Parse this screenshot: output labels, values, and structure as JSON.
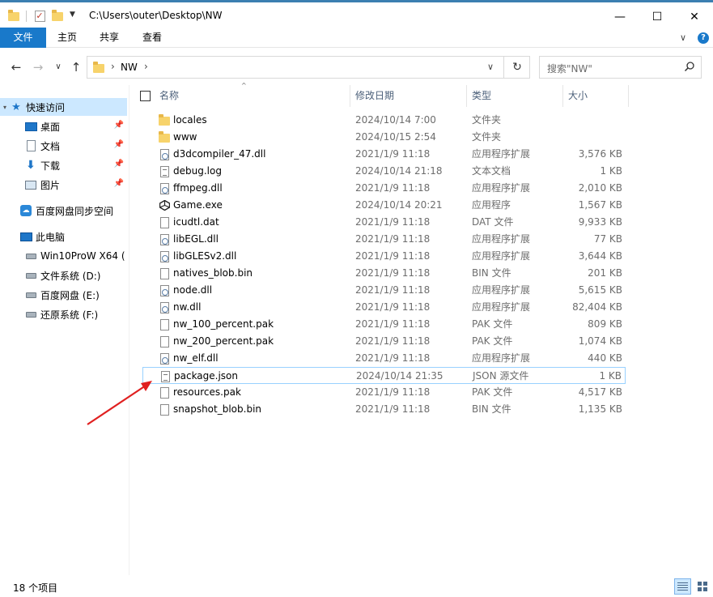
{
  "window": {
    "title_path": "C:\\Users\\outer\\Desktop\\NW",
    "minimize_glyph": "—",
    "maximize_glyph": "☐",
    "close_glyph": "✕"
  },
  "ribbon": {
    "tabs": [
      "文件",
      "主页",
      "共享",
      "查看"
    ],
    "expand_glyph": "∨",
    "help_glyph": "?"
  },
  "address": {
    "back_glyph": "←",
    "forward_glyph": "→",
    "recent_glyph": "∨",
    "up_glyph": "↑",
    "folder_name": "NW",
    "chevron": "›",
    "dropdown_glyph": "∨",
    "refresh_glyph": "↻",
    "search_placeholder": "搜索\"NW\""
  },
  "nav": {
    "quick_access": "快速访问",
    "pinned": [
      "桌面",
      "文档",
      "下载",
      "图片"
    ],
    "cloud_sync": "百度网盘同步空间",
    "this_pc": "此电脑",
    "drives": [
      "Win10ProW X64 (",
      "文件系统 (D:)",
      "百度网盘 (E:)",
      "还原系统 (F:)"
    ],
    "icons": {
      "quick_access": "star-icon",
      "desktop": "desktop-icon",
      "documents": "document-icon",
      "downloads": "download-icon",
      "pictures": "pictures-icon",
      "cloud": "baidu-cloud-icon",
      "pc": "computer-icon",
      "drive": "drive-icon",
      "pin": "pin-icon"
    }
  },
  "columns": {
    "name": "名称",
    "date": "修改日期",
    "type": "类型",
    "size": "大小"
  },
  "files": [
    {
      "name": "locales",
      "date": "2024/10/14 7:00",
      "type": "文件夹",
      "size": "",
      "icon": "folder"
    },
    {
      "name": "www",
      "date": "2024/10/15 2:54",
      "type": "文件夹",
      "size": "",
      "icon": "folder"
    },
    {
      "name": "d3dcompiler_47.dll",
      "date": "2021/1/9 11:18",
      "type": "应用程序扩展",
      "size": "3,576 KB",
      "icon": "dll"
    },
    {
      "name": "debug.log",
      "date": "2024/10/14 21:18",
      "type": "文本文档",
      "size": "1 KB",
      "icon": "text"
    },
    {
      "name": "ffmpeg.dll",
      "date": "2021/1/9 11:18",
      "type": "应用程序扩展",
      "size": "2,010 KB",
      "icon": "dll"
    },
    {
      "name": "Game.exe",
      "date": "2024/10/14 20:21",
      "type": "应用程序",
      "size": "1,567 KB",
      "icon": "exe"
    },
    {
      "name": "icudtl.dat",
      "date": "2021/1/9 11:18",
      "type": "DAT 文件",
      "size": "9,933 KB",
      "icon": "file"
    },
    {
      "name": "libEGL.dll",
      "date": "2021/1/9 11:18",
      "type": "应用程序扩展",
      "size": "77 KB",
      "icon": "dll"
    },
    {
      "name": "libGLESv2.dll",
      "date": "2021/1/9 11:18",
      "type": "应用程序扩展",
      "size": "3,644 KB",
      "icon": "dll"
    },
    {
      "name": "natives_blob.bin",
      "date": "2021/1/9 11:18",
      "type": "BIN 文件",
      "size": "201 KB",
      "icon": "file"
    },
    {
      "name": "node.dll",
      "date": "2021/1/9 11:18",
      "type": "应用程序扩展",
      "size": "5,615 KB",
      "icon": "dll"
    },
    {
      "name": "nw.dll",
      "date": "2021/1/9 11:18",
      "type": "应用程序扩展",
      "size": "82,404 KB",
      "icon": "dll"
    },
    {
      "name": "nw_100_percent.pak",
      "date": "2021/1/9 11:18",
      "type": "PAK 文件",
      "size": "809 KB",
      "icon": "file"
    },
    {
      "name": "nw_200_percent.pak",
      "date": "2021/1/9 11:18",
      "type": "PAK 文件",
      "size": "1,074 KB",
      "icon": "file"
    },
    {
      "name": "nw_elf.dll",
      "date": "2021/1/9 11:18",
      "type": "应用程序扩展",
      "size": "440 KB",
      "icon": "dll"
    },
    {
      "name": "package.json",
      "date": "2024/10/14 21:35",
      "type": "JSON 源文件",
      "size": "1 KB",
      "icon": "json",
      "focused": true
    },
    {
      "name": "resources.pak",
      "date": "2021/1/9 11:18",
      "type": "PAK 文件",
      "size": "4,517 KB",
      "icon": "file"
    },
    {
      "name": "snapshot_blob.bin",
      "date": "2021/1/9 11:18",
      "type": "BIN 文件",
      "size": "1,135 KB",
      "icon": "file"
    }
  ],
  "status": {
    "item_count": "18 个项目"
  },
  "colors": {
    "accent": "#1979ca",
    "selection": "#cce8ff",
    "focus_border": "#99d1ff",
    "annotation_arrow": "#e02020"
  }
}
